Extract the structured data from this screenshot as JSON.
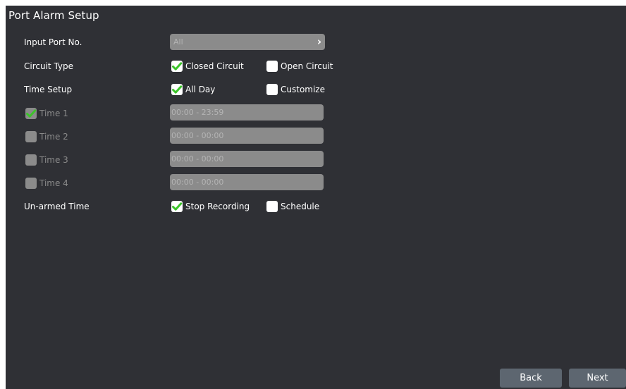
{
  "page": {
    "title": "Port Alarm Setup"
  },
  "fields": {
    "input_port": {
      "label": "Input Port No.",
      "value": "All"
    },
    "circuit_type": {
      "label": "Circuit Type",
      "options": [
        {
          "label": "Closed Circuit",
          "checked": true
        },
        {
          "label": "Open Circuit",
          "checked": false
        }
      ]
    },
    "time_setup": {
      "label": "Time Setup",
      "options": [
        {
          "label": "All Day",
          "checked": true
        },
        {
          "label": "Customize",
          "checked": false
        }
      ]
    },
    "times": [
      {
        "label": "Time 1",
        "checked": true,
        "value": "00:00 - 23:59"
      },
      {
        "label": "Time 2",
        "checked": false,
        "value": "00:00 - 00:00"
      },
      {
        "label": "Time 3",
        "checked": false,
        "value": "00:00 - 00:00"
      },
      {
        "label": "Time 4",
        "checked": false,
        "value": "00:00 - 00:00"
      }
    ],
    "unarmed_time": {
      "label": "Un-armed Time",
      "options": [
        {
          "label": "Stop Recording",
          "checked": true
        },
        {
          "label": "Schedule",
          "checked": false
        }
      ]
    }
  },
  "footer": {
    "back_label": "Back",
    "next_label": "Next"
  },
  "colors": {
    "background": "#2f3035",
    "check_green": "#3cc42a",
    "field_gray": "#8b8b8b",
    "button": "#5d6670"
  }
}
